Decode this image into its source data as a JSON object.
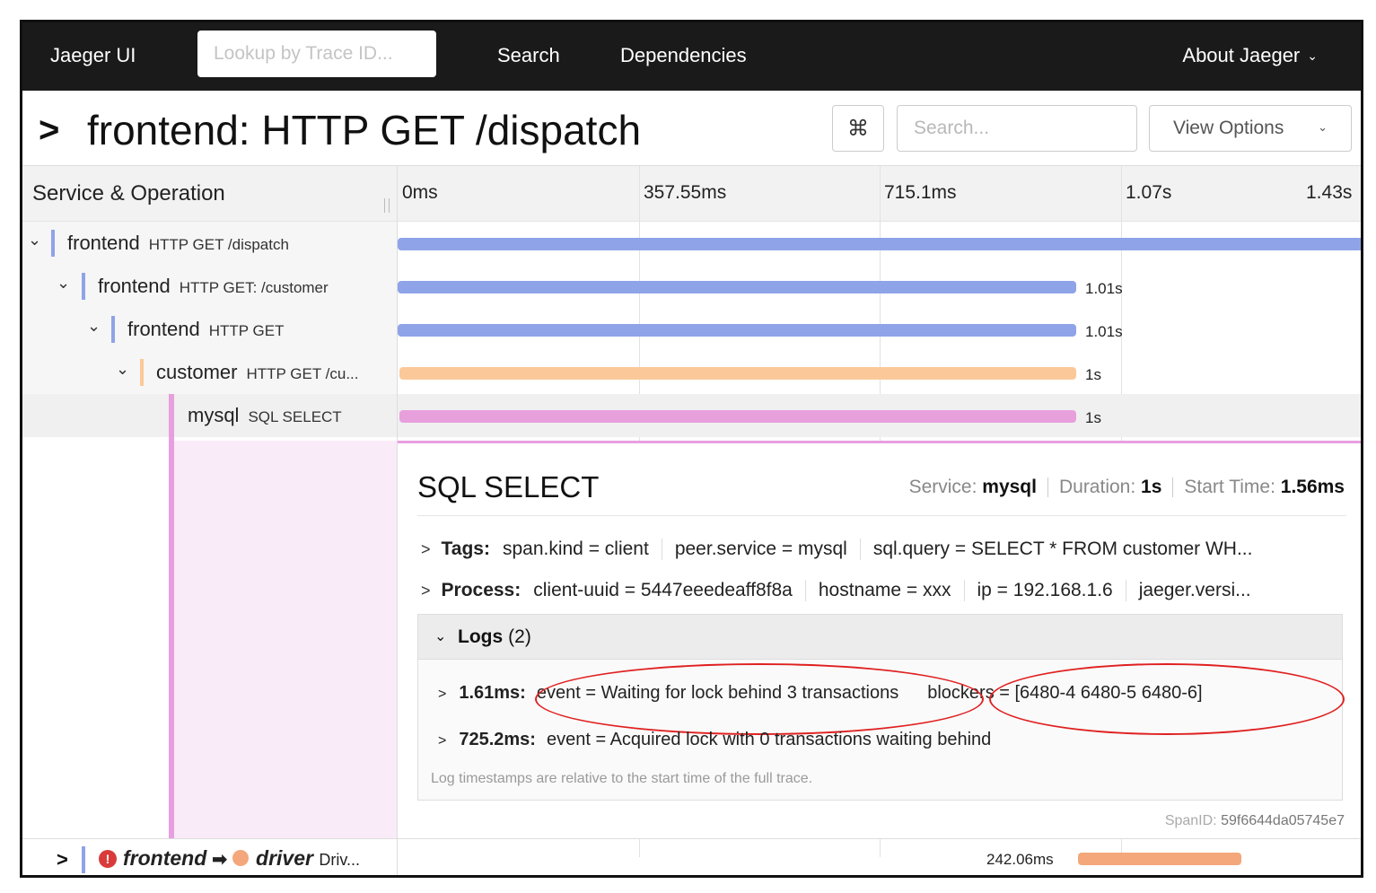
{
  "nav": {
    "brand": "Jaeger UI",
    "lookup_placeholder": "Lookup by Trace ID...",
    "links": [
      "Search",
      "Dependencies"
    ],
    "about": "About Jaeger"
  },
  "trace": {
    "title": "frontend: HTTP GET /dispatch",
    "keyboard_icon": "⌘",
    "search_placeholder": "Search...",
    "view_options": "View Options"
  },
  "columns": {
    "left_header": "Service & Operation",
    "ticks": [
      "0ms",
      "357.55ms",
      "715.1ms",
      "1.07s",
      "1.43s"
    ]
  },
  "spans": [
    {
      "service": "frontend",
      "operation": "HTTP GET /dispatch",
      "duration": "",
      "color": "#8fa3e8",
      "depth": 0,
      "expanded": true
    },
    {
      "service": "frontend",
      "operation": "HTTP GET: /customer",
      "duration": "1.01s",
      "color": "#8fa3e8",
      "depth": 1,
      "expanded": true
    },
    {
      "service": "frontend",
      "operation": "HTTP GET",
      "duration": "1.01s",
      "color": "#8fa3e8",
      "depth": 2,
      "expanded": true
    },
    {
      "service": "customer",
      "operation": "HTTP GET /cu...",
      "duration": "1s",
      "color": "#fbc999",
      "depth": 3,
      "expanded": true
    },
    {
      "service": "mysql",
      "operation": "SQL SELECT",
      "duration": "1s",
      "color": "#e8a0dd",
      "depth": 4,
      "expanded": false
    }
  ],
  "detail": {
    "title": "SQL SELECT",
    "service_label": "Service:",
    "service_value": "mysql",
    "duration_label": "Duration:",
    "duration_value": "1s",
    "start_label": "Start Time:",
    "start_value": "1.56ms",
    "tags_label": "Tags:",
    "tags": [
      "span.kind = client",
      "peer.service = mysql",
      "sql.query = SELECT * FROM customer WH..."
    ],
    "process_label": "Process:",
    "process": [
      "client-uuid = 5447eeedeaff8f8a",
      "hostname = xxx",
      "ip = 192.168.1.6",
      "jaeger.versi..."
    ],
    "logs_label": "Logs",
    "logs_count": "(2)",
    "logs": [
      {
        "ts": "1.61ms:",
        "fields": [
          "event = Waiting for lock behind 3 transactions",
          "blockers = [6480-4 6480-5 6480-6]"
        ]
      },
      {
        "ts": "725.2ms:",
        "fields": [
          "event = Acquired lock with 0 transactions waiting behind"
        ]
      }
    ],
    "log_note": "Log timestamps are relative to the start time of the full trace.",
    "span_id_label": "SpanID:",
    "span_id": "59f6644da05745e7"
  },
  "bottom_row": {
    "from_service": "frontend",
    "to_service": "driver",
    "operation": "Driv...",
    "duration": "242.06ms",
    "color": "#f4a77a",
    "error_icon": "!"
  },
  "colors": {
    "nav_bg": "#1a1a1a",
    "frontend": "#8fa3e8",
    "customer": "#fbc999",
    "mysql": "#e8a0dd",
    "driver": "#f4a77a",
    "highlight": "#e02020"
  }
}
